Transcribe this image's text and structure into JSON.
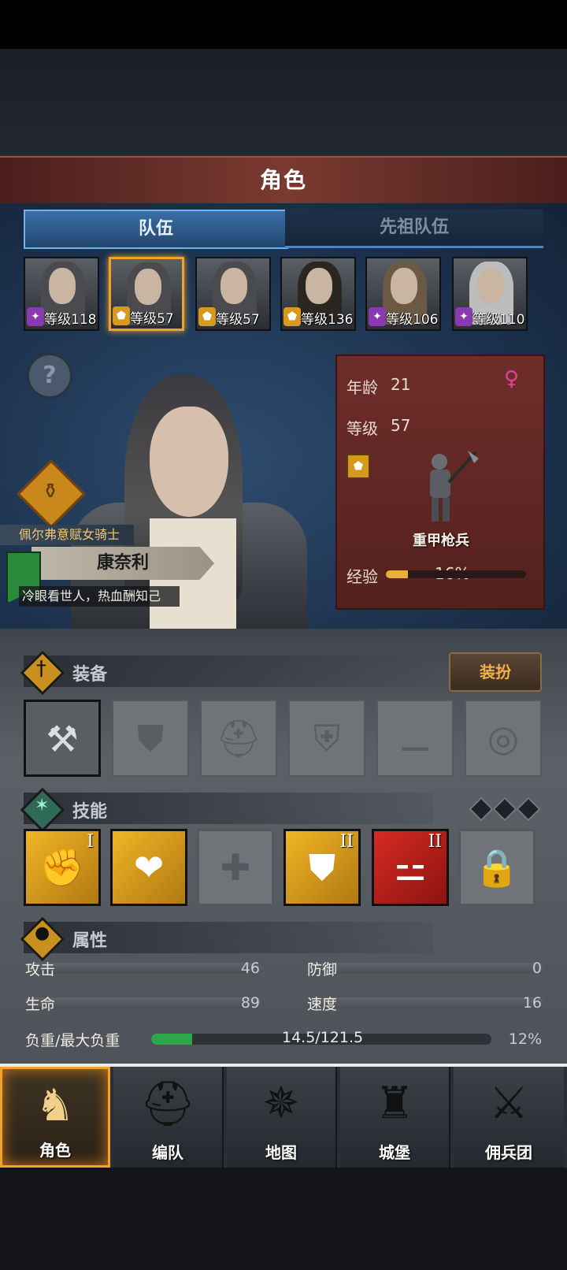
{
  "header": {
    "title": "角色"
  },
  "tabs": [
    {
      "label": "队伍"
    },
    {
      "label": "先祖队伍"
    }
  ],
  "roster": [
    {
      "level": "等级118",
      "class_icon": "magic-wand-icon",
      "selected": false
    },
    {
      "level": "等级57",
      "class_icon": "shield-icon",
      "selected": true
    },
    {
      "level": "等级57",
      "class_icon": "shield-icon",
      "selected": false
    },
    {
      "level": "等级136",
      "class_icon": "shield-icon",
      "selected": false
    },
    {
      "level": "等级106",
      "class_icon": "magic-wand-icon",
      "selected": false
    },
    {
      "level": "等级110",
      "class_icon": "magic-wand-icon",
      "selected": false
    }
  ],
  "hero": {
    "class_title": "佩尔弗意赋女骑士",
    "name": "康奈利",
    "motto": "冷眼看世人，热血酬知己"
  },
  "info": {
    "age_label": "年龄",
    "age": "21",
    "level_label": "等级",
    "level": "57",
    "unit_class": "重甲枪兵",
    "exp_label": "经验",
    "exp_percent": "16%",
    "exp_fraction": 0.16
  },
  "equipment": {
    "title": "装备",
    "dress_button": "装扮",
    "slots": [
      "hammer-icon",
      "shield-slot-icon",
      "helmet-slot-icon",
      "armor-slot-icon",
      "boots-slot-icon",
      "ring-slot-icon"
    ]
  },
  "skills": {
    "title": "技能",
    "items": [
      {
        "icon": "gauntlet-strike-icon",
        "rank": "I",
        "style": "gold"
      },
      {
        "icon": "heart-fist-icon",
        "rank": "",
        "style": "gold"
      },
      {
        "icon": "cross-slot-icon",
        "rank": "",
        "style": "empty"
      },
      {
        "icon": "shield-block-icon",
        "rank": "II",
        "style": "gold"
      },
      {
        "icon": "dumbbell-icon",
        "rank": "II",
        "style": "red"
      },
      {
        "icon": "lock-icon",
        "rank": "",
        "style": "empty"
      }
    ]
  },
  "attributes": {
    "title": "属性",
    "attack_label": "攻击",
    "attack": "46",
    "defense_label": "防御",
    "defense": "0",
    "hp_label": "生命",
    "hp": "89",
    "speed_label": "速度",
    "speed": "16",
    "load_label": "负重/最大负重",
    "load_value": "14.5/121.5",
    "load_percent": "12%",
    "load_fraction": 0.12
  },
  "nav": [
    {
      "label": "角色",
      "icon": "knight-icon",
      "active": true
    },
    {
      "label": "编队",
      "icon": "helmet-icon",
      "active": false
    },
    {
      "label": "地图",
      "icon": "compass-icon",
      "active": false
    },
    {
      "label": "城堡",
      "icon": "castle-icon",
      "active": false
    },
    {
      "label": "佣兵团",
      "icon": "mercenary-icon",
      "active": false
    }
  ],
  "colors": {
    "accent": "#f0a22a",
    "title_red": "#7a3a30",
    "team_tab": "#3a6ea8",
    "female": "#e23fa0"
  }
}
